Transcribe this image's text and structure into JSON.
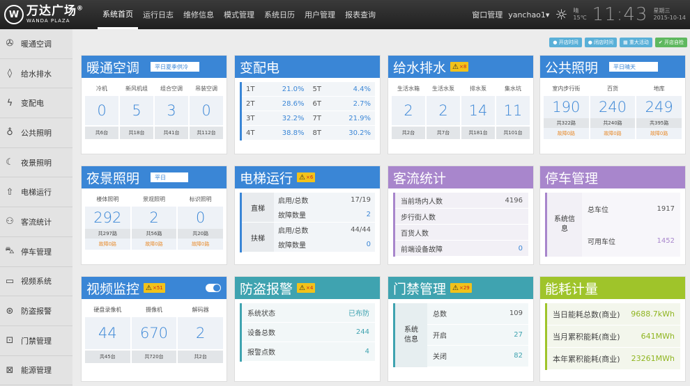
{
  "brand": {
    "name": "万达广场",
    "registered": "®",
    "name_en": "WANDA PLAZA"
  },
  "nav": [
    {
      "label": "系统首页",
      "active": true
    },
    {
      "label": "运行日志"
    },
    {
      "label": "维修信息"
    },
    {
      "label": "模式管理"
    },
    {
      "label": "系统日历"
    },
    {
      "label": "用户管理"
    },
    {
      "label": "报表查询"
    }
  ],
  "header": {
    "window_mgmt": "窗口管理",
    "user": "yanchao1",
    "user_caret": "▾",
    "weather_label": "晴",
    "temperature": "15℃",
    "time": "11:43",
    "weekday": "星期三",
    "date": "2015-10-14"
  },
  "sidebar": [
    {
      "label": "暖通空调",
      "icon": "fan-icon"
    },
    {
      "label": "给水排水",
      "icon": "water-drop-icon"
    },
    {
      "label": "变配电",
      "icon": "lightning-icon"
    },
    {
      "label": "公共照明",
      "icon": "bulb-icon"
    },
    {
      "label": "夜景照明",
      "icon": "moon-icon"
    },
    {
      "label": "电梯运行",
      "icon": "elevator-icon"
    },
    {
      "label": "客流统计",
      "icon": "people-icon"
    },
    {
      "label": "停车管理",
      "icon": "car-icon"
    },
    {
      "label": "视频系统",
      "icon": "camera-icon"
    },
    {
      "label": "防盗报警",
      "icon": "alarm-icon"
    },
    {
      "label": "门禁管理",
      "icon": "lock-icon"
    },
    {
      "label": "能源管理",
      "icon": "chart-icon"
    }
  ],
  "actions": [
    {
      "label": "● 开店时间"
    },
    {
      "label": "● 闭店时间"
    },
    {
      "label": "▦ 重大活动"
    },
    {
      "label": "✔ 开店自检"
    }
  ],
  "hvac": {
    "title": "暖通空调",
    "mode": "平日夏季供冷",
    "items": [
      {
        "label": "冷机",
        "value": "0",
        "total": "共6台"
      },
      {
        "label": "新风机组",
        "value": "5",
        "total": "共18台"
      },
      {
        "label": "组合空调",
        "value": "3",
        "total": "共41台"
      },
      {
        "label": "吊装空调",
        "value": "0",
        "total": "共112台"
      }
    ]
  },
  "power": {
    "title": "变配电",
    "rows": [
      {
        "a": "1T",
        "av": "21.0%",
        "b": "5T",
        "bv": "4.4%"
      },
      {
        "a": "2T",
        "av": "28.6%",
        "b": "6T",
        "bv": "2.7%"
      },
      {
        "a": "3T",
        "av": "32.2%",
        "b": "7T",
        "bv": "21.9%"
      },
      {
        "a": "4T",
        "av": "38.8%",
        "b": "8T",
        "bv": "30.2%"
      }
    ]
  },
  "water": {
    "title": "给水排水",
    "warn": "×8",
    "items": [
      {
        "label": "生活水箱",
        "value": "2",
        "total": "共2台"
      },
      {
        "label": "生活水泵",
        "value": "2",
        "total": "共7台"
      },
      {
        "label": "排水泵",
        "value": "14",
        "total": "共181台"
      },
      {
        "label": "集水坑",
        "value": "11",
        "total": "共101台"
      }
    ]
  },
  "public_light": {
    "title": "公共照明",
    "mode": "平日晴天",
    "items": [
      {
        "label": "室内步行街",
        "value": "190",
        "total": "共322路",
        "fault": "故障0路"
      },
      {
        "label": "百货",
        "value": "240",
        "total": "共240路",
        "fault": "故障0路"
      },
      {
        "label": "地库",
        "value": "249",
        "total": "共395路",
        "fault": "故障0路"
      }
    ]
  },
  "night_light": {
    "title": "夜景照明",
    "mode": "平日",
    "items": [
      {
        "label": "楼体照明",
        "value": "292",
        "total": "共297路",
        "fault": "故障0路"
      },
      {
        "label": "景观照明",
        "value": "2",
        "total": "共56路",
        "fault": "故障0路"
      },
      {
        "label": "标识照明",
        "value": "0",
        "total": "共20路",
        "fault": "故障0路"
      }
    ]
  },
  "elevator": {
    "title": "电梯运行",
    "warn": "×6",
    "groups": [
      {
        "name": "直梯",
        "rows": [
          {
            "k": "启用/总数",
            "v": "17/19"
          },
          {
            "k": "故障数量",
            "v": "2"
          }
        ]
      },
      {
        "name": "扶梯",
        "rows": [
          {
            "k": "启用/总数",
            "v": "44/44"
          },
          {
            "k": "故障数量",
            "v": "0"
          }
        ]
      }
    ]
  },
  "traffic": {
    "title": "客流统计",
    "rows": [
      {
        "k": "当前场内人数",
        "v": "4196"
      },
      {
        "k": "步行街人数",
        "v": ""
      },
      {
        "k": "百货人数",
        "v": ""
      },
      {
        "k": "前端设备故障",
        "v": "0"
      }
    ]
  },
  "parking": {
    "title": "停车管理",
    "side": "系统信息",
    "rows": [
      {
        "k": "总车位",
        "v": "1917"
      },
      {
        "k": "可用车位",
        "v": "1452"
      }
    ]
  },
  "video": {
    "title": "视频监控",
    "warn": "×51",
    "items": [
      {
        "label": "硬盘录像机",
        "value": "44",
        "total": "共45台"
      },
      {
        "label": "摄像机",
        "value": "670",
        "total": "共720台"
      },
      {
        "label": "解码器",
        "value": "2",
        "total": "共2台"
      }
    ]
  },
  "burglar": {
    "title": "防盗报警",
    "warn": "×4",
    "rows": [
      {
        "k": "系统状态",
        "v": "已布防"
      },
      {
        "k": "设备总数",
        "v": "244"
      },
      {
        "k": "报警点数",
        "v": "4"
      }
    ]
  },
  "access": {
    "title": "门禁管理",
    "warn": "×29",
    "side": "系统信息",
    "rows": [
      {
        "k": "总数",
        "v": "109"
      },
      {
        "k": "开启",
        "v": "27"
      },
      {
        "k": "关闭",
        "v": "82"
      }
    ]
  },
  "energy": {
    "title": "能耗计量",
    "rows": [
      {
        "k": "当日能耗总数(商业)",
        "v": "9688.7kWh"
      },
      {
        "k": "当月累积能耗(商业)",
        "v": "641MWh"
      },
      {
        "k": "本年累积能耗(商业)",
        "v": "23261MWh"
      }
    ]
  }
}
